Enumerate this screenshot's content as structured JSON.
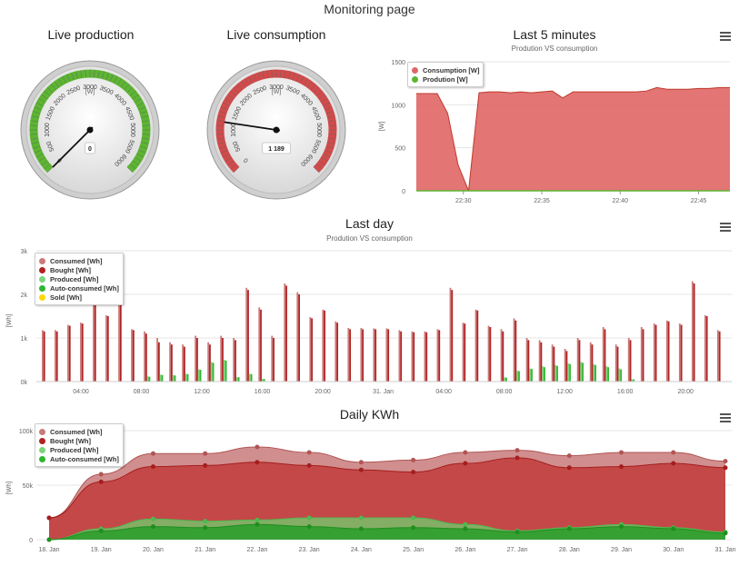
{
  "page_title": "Monitoring page",
  "menu_icon": "hamburger-menu-icon",
  "colors": {
    "consumption": "#e06666",
    "consumption_line": "#c0392b",
    "bought": "#b22222",
    "produced": "#7cd67c",
    "auto_consumed": "#2fb52f",
    "sold": "#ffd700",
    "gauge_green": "#5cb531",
    "gauge_red": "#d24a4a"
  },
  "gauges": [
    {
      "title": "Live production",
      "unit": "[W]",
      "value": 0,
      "value_label": "0",
      "min": 0,
      "max": 6000,
      "tick_labels": [
        "0",
        "500",
        "1000",
        "1500",
        "2000",
        "2500",
        "3000",
        "3500",
        "4000",
        "4500",
        "5000",
        "5500",
        "6000"
      ],
      "band_color": "#5cb531"
    },
    {
      "title": "Live consumption",
      "unit": "[W]",
      "value": 1189,
      "value_label": "1 189",
      "min": 0,
      "max": 6000,
      "tick_labels": [
        "0",
        "500",
        "1000",
        "1500",
        "2000",
        "2500",
        "3000",
        "3500",
        "4000",
        "4500",
        "5000",
        "5500",
        "6000"
      ],
      "band_color": "#d24a4a"
    }
  ],
  "last5": {
    "title": "Last 5 minutes",
    "subtitle": "Prodution VS consumption",
    "ylabel": "[W]",
    "legend": [
      "Consumption [W]",
      "Prodution [W]"
    ]
  },
  "lastday": {
    "title": "Last day",
    "subtitle": "Prodution VS consumption",
    "ylabel": "[Wh]",
    "legend": [
      "Consumed [Wh]",
      "Bought [Wh]",
      "Produced [Wh]",
      "Auto-consumed [Wh]",
      "Sold [Wh]"
    ]
  },
  "daily": {
    "title": "Daily KWh",
    "ylabel": "[Wh]",
    "legend": [
      "Consumed [Wh]",
      "Bought [Wh]",
      "Produced [Wh]",
      "Auto-consumed [Wh]"
    ]
  },
  "chart_data": [
    {
      "type": "area",
      "title": "Last 5 minutes",
      "subtitle": "Prodution VS consumption",
      "ylabel": "[W]",
      "ylim": [
        0,
        1500
      ],
      "y_ticks": [
        0,
        500,
        1000,
        1500
      ],
      "x_ticks": [
        "22:30",
        "22:35",
        "22:40",
        "22:45"
      ],
      "x_minutes": [
        0,
        2,
        3,
        4,
        5,
        6,
        7,
        8,
        9,
        10,
        11,
        12,
        13,
        14,
        15,
        16,
        17,
        18,
        19,
        20,
        21,
        22,
        23,
        24,
        25,
        26,
        27,
        28,
        29,
        30
      ],
      "series": [
        {
          "name": "Consumption [W]",
          "values": [
            1130,
            1130,
            900,
            300,
            0,
            1140,
            1150,
            1150,
            1140,
            1150,
            1140,
            1150,
            1160,
            1080,
            1150,
            1150,
            1150,
            1150,
            1150,
            1150,
            1150,
            1160,
            1200,
            1180,
            1180,
            1180,
            1190,
            1190,
            1200,
            1200
          ]
        },
        {
          "name": "Prodution [W]",
          "values": [
            0,
            0,
            0,
            0,
            0,
            0,
            0,
            0,
            0,
            0,
            0,
            0,
            0,
            0,
            0,
            0,
            0,
            0,
            0,
            0,
            0,
            0,
            0,
            0,
            0,
            0,
            0,
            0,
            0,
            0
          ]
        }
      ],
      "grid": true,
      "legend_position": "top-left"
    },
    {
      "type": "bar",
      "title": "Last day",
      "subtitle": "Prodution VS consumption",
      "ylabel": "[Wh]",
      "ylim": [
        0,
        3000
      ],
      "y_ticks": [
        "0k",
        "1k",
        "2k",
        "3k"
      ],
      "x_ticks": [
        "04:00",
        "08:00",
        "12:00",
        "16:00",
        "20:00",
        "31. Jan",
        "04:00",
        "08:00",
        "12:00",
        "16:00",
        "20:00"
      ],
      "series": [
        {
          "name": "Consumed [Wh]",
          "values": [
            1180,
            1180,
            1300,
            1350,
            2100,
            1520,
            1780,
            1200,
            1150,
            1000,
            900,
            850,
            1050,
            900,
            1050,
            1000,
            2150,
            1700,
            1050,
            2250,
            2050,
            1480,
            1650,
            1380,
            1230,
            1230,
            1220,
            1220,
            1180,
            1150,
            1150,
            1200,
            2150,
            1350,
            1650,
            1280,
            1200,
            1450,
            1000,
            950,
            850,
            750,
            1000,
            900,
            1250,
            850,
            1000,
            1250,
            1330,
            1400,
            1330,
            2300,
            1520,
            1180
          ]
        },
        {
          "name": "Bought [Wh]",
          "values": [
            1150,
            1150,
            1280,
            1330,
            2050,
            1500,
            1750,
            1180,
            1100,
            900,
            850,
            800,
            1000,
            850,
            1000,
            950,
            2100,
            1650,
            1000,
            2200,
            2000,
            1450,
            1630,
            1350,
            1200,
            1200,
            1200,
            1200,
            1150,
            1130,
            1130,
            1180,
            2100,
            1330,
            1630,
            1250,
            1150,
            1400,
            950,
            900,
            800,
            700,
            950,
            850,
            1200,
            800,
            950,
            1200,
            1300,
            1380,
            1300,
            2250,
            1500,
            1150
          ]
        },
        {
          "name": "Produced [Wh]",
          "values": [
            0,
            0,
            0,
            0,
            0,
            0,
            0,
            10,
            120,
            160,
            150,
            180,
            280,
            450,
            500,
            100,
            180,
            60,
            0,
            0,
            0,
            0,
            0,
            0,
            0,
            0,
            0,
            0,
            0,
            0,
            0,
            0,
            0,
            0,
            0,
            0,
            100,
            250,
            300,
            350,
            380,
            420,
            450,
            400,
            350,
            300,
            50,
            0,
            0,
            0,
            0,
            0,
            0,
            0
          ]
        },
        {
          "name": "Auto-consumed [Wh]",
          "values": [
            0,
            0,
            0,
            0,
            0,
            0,
            0,
            10,
            110,
            150,
            140,
            170,
            270,
            430,
            480,
            100,
            170,
            60,
            0,
            0,
            0,
            0,
            0,
            0,
            0,
            0,
            0,
            0,
            0,
            0,
            0,
            0,
            0,
            0,
            0,
            0,
            90,
            240,
            290,
            330,
            360,
            400,
            430,
            380,
            330,
            280,
            50,
            0,
            0,
            0,
            0,
            0,
            0,
            0
          ]
        },
        {
          "name": "Sold [Wh]",
          "values": [
            0,
            0,
            0,
            0,
            0,
            0,
            0,
            0,
            0,
            0,
            0,
            0,
            0,
            0,
            0,
            0,
            0,
            0,
            0,
            0,
            0,
            0,
            0,
            0,
            0,
            0,
            0,
            0,
            0,
            0,
            0,
            0,
            0,
            0,
            0,
            0,
            0,
            0,
            0,
            0,
            0,
            0,
            0,
            0,
            0,
            0,
            0,
            0,
            0,
            0,
            0,
            0,
            0,
            0
          ]
        }
      ],
      "grid": true,
      "legend_position": "top-left"
    },
    {
      "type": "area",
      "title": "Daily KWh",
      "ylabel": "[Wh]",
      "ylim": [
        0,
        100000
      ],
      "y_ticks": [
        "0",
        "50k",
        "100k"
      ],
      "categories": [
        "18. Jan",
        "19. Jan",
        "20. Jan",
        "21. Jan",
        "22. Jan",
        "23. Jan",
        "24. Jan",
        "25. Jan",
        "26. Jan",
        "27. Jan",
        "28. Jan",
        "29. Jan",
        "30. Jan",
        "31. Jan"
      ],
      "series": [
        {
          "name": "Consumed [Wh]",
          "values": [
            20000,
            60000,
            79000,
            79000,
            85000,
            80000,
            71000,
            73000,
            80000,
            82000,
            77000,
            80000,
            80000,
            72000
          ]
        },
        {
          "name": "Bought [Wh]",
          "values": [
            20000,
            53000,
            67000,
            68000,
            71000,
            68000,
            64000,
            62000,
            70000,
            75000,
            66000,
            67000,
            70000,
            66000
          ]
        },
        {
          "name": "Produced [Wh]",
          "values": [
            0,
            10000,
            19000,
            17000,
            18000,
            20000,
            20000,
            20000,
            14000,
            8000,
            11000,
            14000,
            11000,
            7000
          ]
        },
        {
          "name": "Auto-consumed [Wh]",
          "values": [
            0,
            8000,
            12000,
            11000,
            14000,
            12000,
            10000,
            11000,
            10000,
            7000,
            10000,
            12000,
            10000,
            6000
          ]
        }
      ],
      "grid": true,
      "legend_position": "top-left"
    }
  ]
}
